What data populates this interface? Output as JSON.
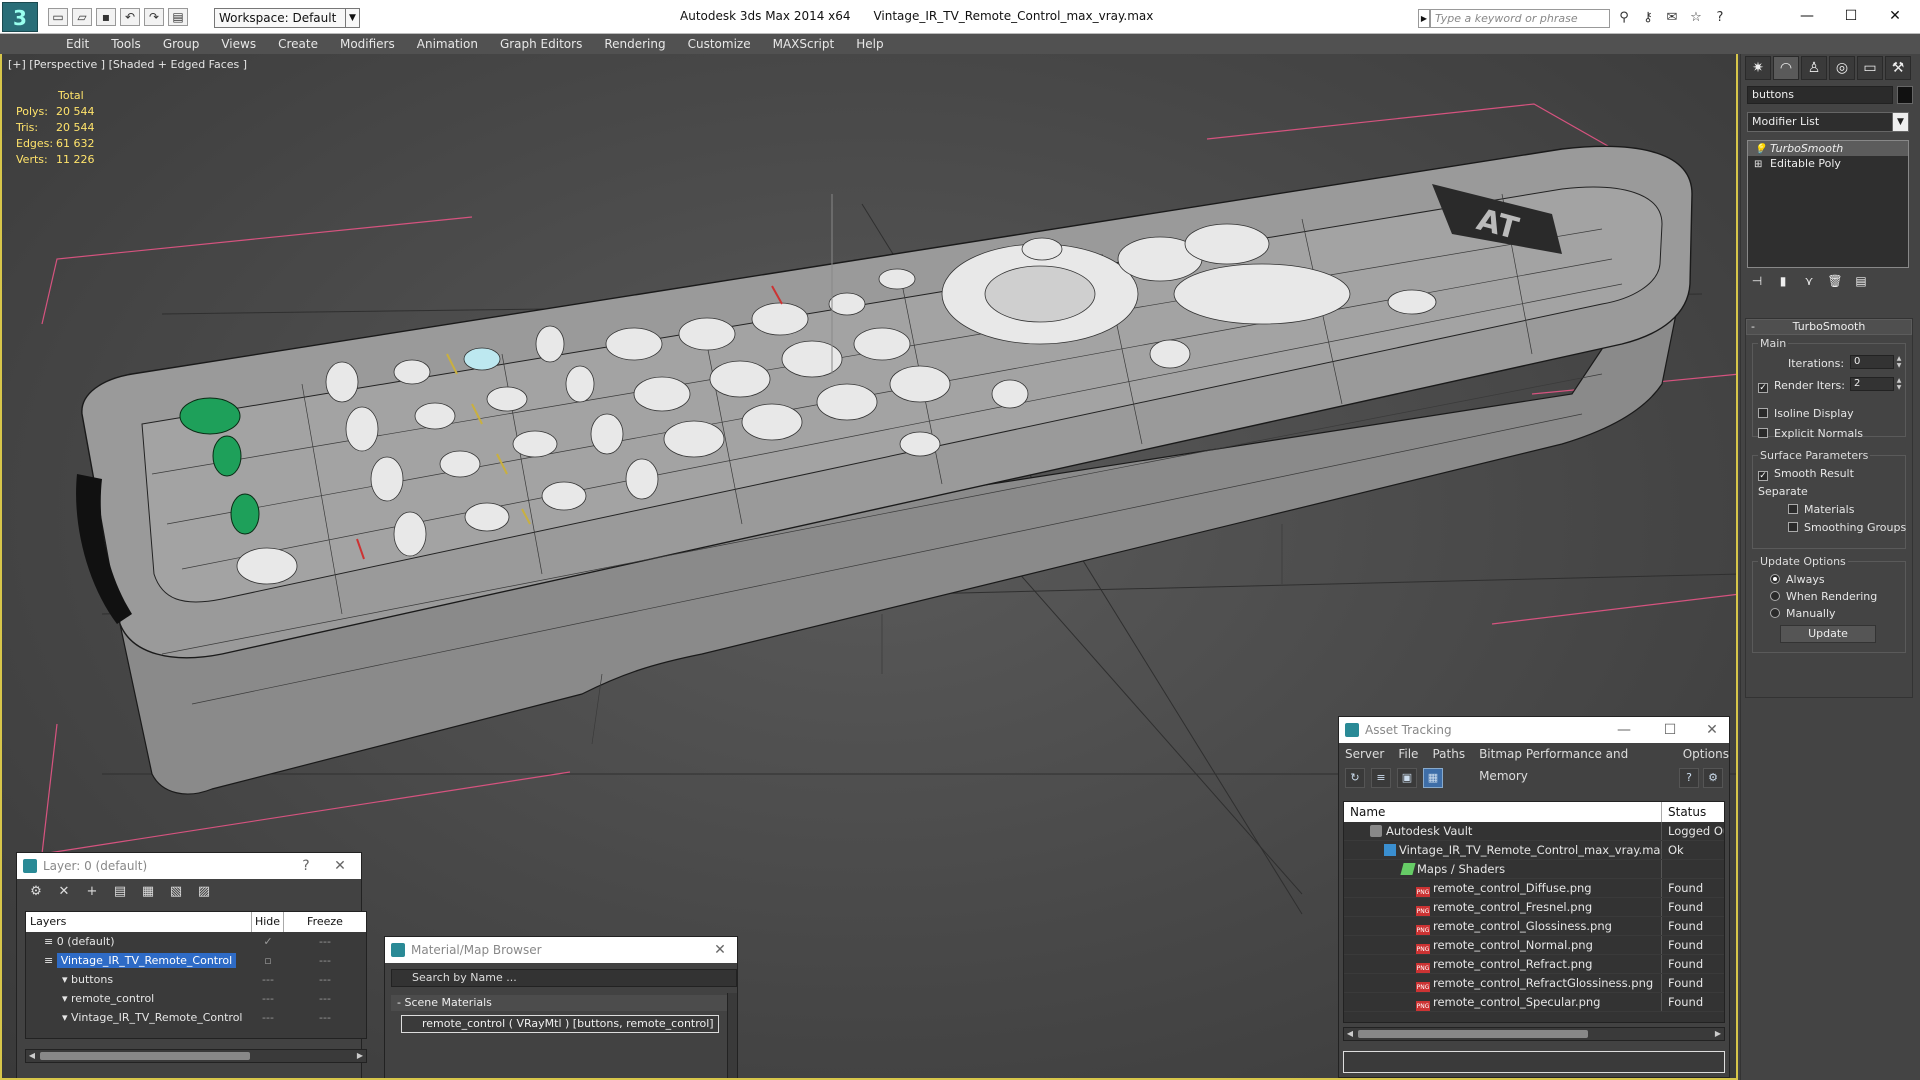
{
  "titlebar": {
    "workspace": "Workspace: Default",
    "app": "Autodesk 3ds Max  2014 x64",
    "file": "Vintage_IR_TV_Remote_Control_max_vray.max",
    "search_placeholder": "Type a keyword or phrase",
    "minimize": "—",
    "maximize": "☐",
    "close": "✕"
  },
  "menu": [
    "Edit",
    "Tools",
    "Group",
    "Views",
    "Create",
    "Modifiers",
    "Animation",
    "Graph Editors",
    "Rendering",
    "Customize",
    "MAXScript",
    "Help"
  ],
  "viewport": {
    "label": "[+] [Perspective ] [Shaded + Edged Faces ]",
    "stats": {
      "header": "Total",
      "polys_label": "Polys:",
      "polys": "20 544",
      "tris_label": "Tris:",
      "tris": "20 544",
      "edges_label": "Edges:",
      "edges": "61 632",
      "verts_label": "Verts:",
      "verts": "11 226"
    },
    "logo_text": "AT"
  },
  "command_panel": {
    "object_name": "buttons",
    "modifier_list": "Modifier List",
    "stack": [
      "TurboSmooth",
      "Editable Poly"
    ],
    "rollout_title": "TurboSmooth",
    "main_label": "Main",
    "iterations_label": "Iterations:",
    "iterations": "0",
    "render_iters_label": "Render Iters:",
    "render_iters": "2",
    "isoline": "Isoline Display",
    "explicit_normals": "Explicit Normals",
    "surface_params": "Surface Parameters",
    "smooth_result": "Smooth Result",
    "separate": "Separate",
    "materials": "Materials",
    "smoothing_groups": "Smoothing Groups",
    "update_options": "Update Options",
    "always": "Always",
    "when_rendering": "When Rendering",
    "manually": "Manually",
    "update_button": "Update"
  },
  "asset_tracking": {
    "title": "Asset Tracking",
    "menu": [
      "Server",
      "File",
      "Paths",
      "Bitmap Performance and Memory",
      "Options"
    ],
    "col_name": "Name",
    "col_status": "Status",
    "rows": [
      {
        "name": "Autodesk Vault",
        "status": "Logged Ou"
      },
      {
        "name": "Vintage_IR_TV_Remote_Control_max_vray.max",
        "status": "Ok"
      },
      {
        "name": "Maps / Shaders",
        "status": ""
      },
      {
        "name": "remote_control_Diffuse.png",
        "status": "Found"
      },
      {
        "name": "remote_control_Fresnel.png",
        "status": "Found"
      },
      {
        "name": "remote_control_Glossiness.png",
        "status": "Found"
      },
      {
        "name": "remote_control_Normal.png",
        "status": "Found"
      },
      {
        "name": "remote_control_Refract.png",
        "status": "Found"
      },
      {
        "name": "remote_control_RefractGlossiness.png",
        "status": "Found"
      },
      {
        "name": "remote_control_Specular.png",
        "status": "Found"
      }
    ]
  },
  "layer": {
    "title": "Layer: 0 (default)",
    "help": "?",
    "col_layers": "Layers",
    "col_hide": "Hide",
    "col_freeze": "Freeze",
    "rows": [
      "0 (default)",
      "Vintage_IR_TV_Remote_Control",
      "buttons",
      "remote_control",
      "Vintage_IR_TV_Remote_Control"
    ]
  },
  "material_browser": {
    "title": "Material/Map Browser",
    "search": "Search by Name ...",
    "category": "- Scene Materials",
    "item": "remote_control  ( VRayMtl )  [buttons, remote_control]"
  }
}
